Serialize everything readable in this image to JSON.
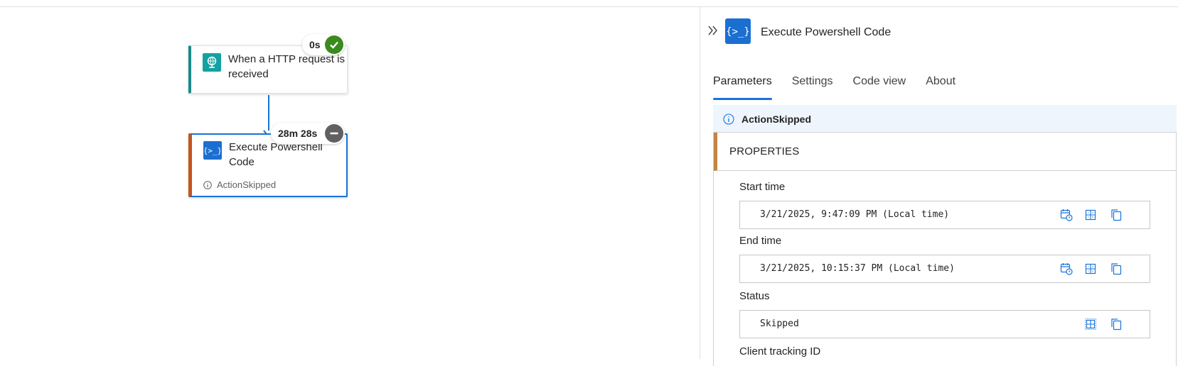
{
  "canvas": {
    "trigger": {
      "title": "When a HTTP request is received",
      "duration": "0s"
    },
    "action": {
      "title": "Execute Powershell Code",
      "duration": "28m 28s",
      "status": "ActionSkipped"
    }
  },
  "panel": {
    "title": "Execute Powershell Code",
    "tabs": [
      "Parameters",
      "Settings",
      "Code view",
      "About"
    ],
    "info_message": "ActionSkipped",
    "section_header": "PROPERTIES",
    "fields": {
      "start_time": {
        "label": "Start time",
        "value": "3/21/2025, 9:47:09 PM (Local time)"
      },
      "end_time": {
        "label": "End time",
        "value": "3/21/2025, 10:15:37 PM (Local time)"
      },
      "status": {
        "label": "Status",
        "value": "Skipped"
      },
      "client_tracking_id": {
        "label": "Client tracking ID"
      }
    }
  },
  "colors": {
    "accent": "#1a73d9",
    "trigger_icon": "#13a1a1",
    "action_icon": "#1b6fd1",
    "success": "#3b8a1d",
    "skipped": "#616161",
    "action_border": "#c2571a"
  }
}
